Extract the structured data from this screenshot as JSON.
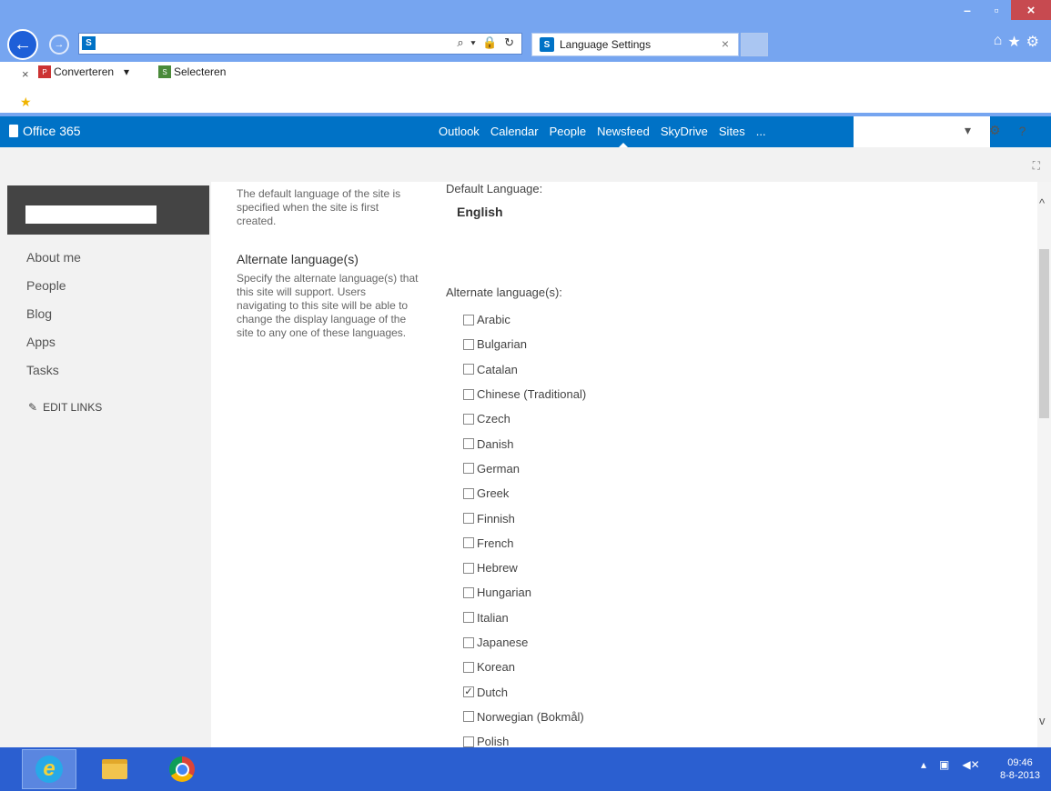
{
  "browser": {
    "tab_title": "Language Settings",
    "tab_close": "×",
    "address_icons": "⌕ ▾ 🔒 ↻",
    "window_controls": {
      "minimize": "–",
      "maximize": "▫",
      "close": "×"
    }
  },
  "toolbar": {
    "close": "×",
    "convert_label": "Converteren",
    "convert_arrow": "▾",
    "select_label": "Selecteren"
  },
  "suite": {
    "brand": "Office 365",
    "nav": [
      "Outlook",
      "Calendar",
      "People",
      "Newsfeed",
      "SkyDrive",
      "Sites",
      "..."
    ],
    "active_nav": "Newsfeed",
    "caret": "▾",
    "settings_icon": "⚙",
    "help": "?"
  },
  "sidebar": {
    "items": [
      "About me",
      "People",
      "Blog",
      "Apps",
      "Tasks"
    ],
    "edit_links": "EDIT LINKS"
  },
  "content": {
    "default_desc": "The default language of the site is specified when the site is first created.",
    "alt_heading": "Alternate language(s)",
    "alt_desc": "Specify the alternate language(s) that this site will support. Users navigating to this site will be able to change the display language of the site to any one of these languages.",
    "default_label": "Default Language:",
    "default_value": "English",
    "alt_label": "Alternate language(s):",
    "languages": [
      {
        "name": "Arabic",
        "checked": false
      },
      {
        "name": "Bulgarian",
        "checked": false
      },
      {
        "name": "Catalan",
        "checked": false
      },
      {
        "name": "Chinese (Traditional)",
        "checked": false
      },
      {
        "name": "Czech",
        "checked": false
      },
      {
        "name": "Danish",
        "checked": false
      },
      {
        "name": "German",
        "checked": false
      },
      {
        "name": "Greek",
        "checked": false
      },
      {
        "name": "Finnish",
        "checked": false
      },
      {
        "name": "French",
        "checked": false
      },
      {
        "name": "Hebrew",
        "checked": false
      },
      {
        "name": "Hungarian",
        "checked": false
      },
      {
        "name": "Italian",
        "checked": false
      },
      {
        "name": "Japanese",
        "checked": false
      },
      {
        "name": "Korean",
        "checked": false
      },
      {
        "name": "Dutch",
        "checked": true
      },
      {
        "name": "Norwegian (Bokmål)",
        "checked": false
      },
      {
        "name": "Polish",
        "checked": false
      }
    ]
  },
  "taskbar": {
    "time": "09:46",
    "date": "8-8-2013"
  },
  "colors": {
    "suite_bar": "#0072c6",
    "chrome": "#76a5f0",
    "taskbar": "#2b5fd0",
    "sidebar": "#f2f2f2"
  }
}
